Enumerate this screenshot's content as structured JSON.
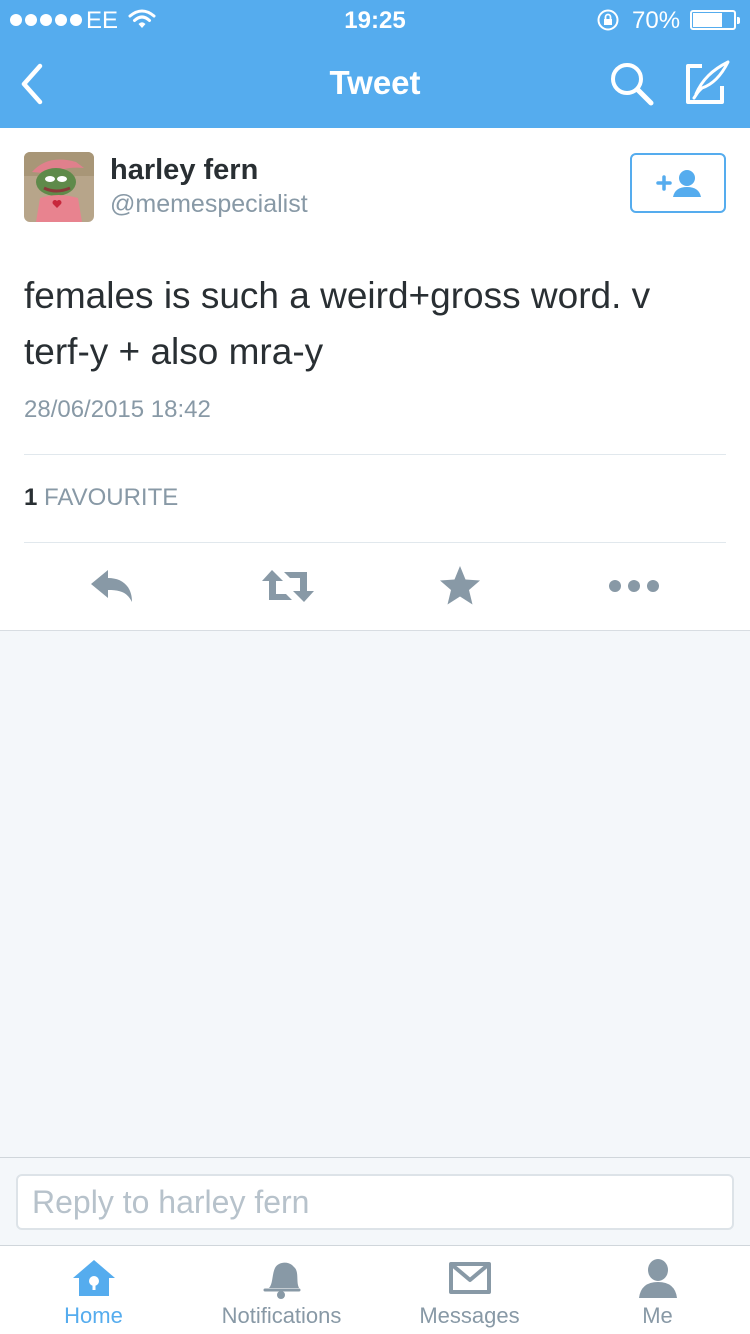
{
  "status_bar": {
    "carrier": "EE",
    "time": "19:25",
    "battery_percent": "70%",
    "battery_level": 0.7,
    "signal_bars": 5
  },
  "nav": {
    "title": "Tweet",
    "back_icon": "chevron-left-icon",
    "search_icon": "search-icon",
    "compose_icon": "compose-icon"
  },
  "tweet": {
    "display_name": "harley fern",
    "handle": "@memespecialist",
    "text": "females is such a weird+gross word. v terf-y + also mra-y",
    "timestamp": "28/06/2015 18:42",
    "favourite_count": "1",
    "favourite_label": "FAVOURITE",
    "follow_icon": "add-user-icon",
    "actions": [
      "reply-icon",
      "retweet-icon",
      "favourite-star-icon",
      "more-icon"
    ]
  },
  "reply": {
    "placeholder": "Reply to harley fern",
    "value": ""
  },
  "tabs": [
    {
      "label": "Home",
      "icon": "home-icon",
      "active": true
    },
    {
      "label": "Notifications",
      "icon": "bell-icon",
      "active": false
    },
    {
      "label": "Messages",
      "icon": "envelope-icon",
      "active": false
    },
    {
      "label": "Me",
      "icon": "person-icon",
      "active": false
    }
  ],
  "colors": {
    "brand_blue": "#55acee",
    "icon_grey": "#8899a6",
    "text_dark": "#292f33",
    "background": "#f4f7fa"
  }
}
